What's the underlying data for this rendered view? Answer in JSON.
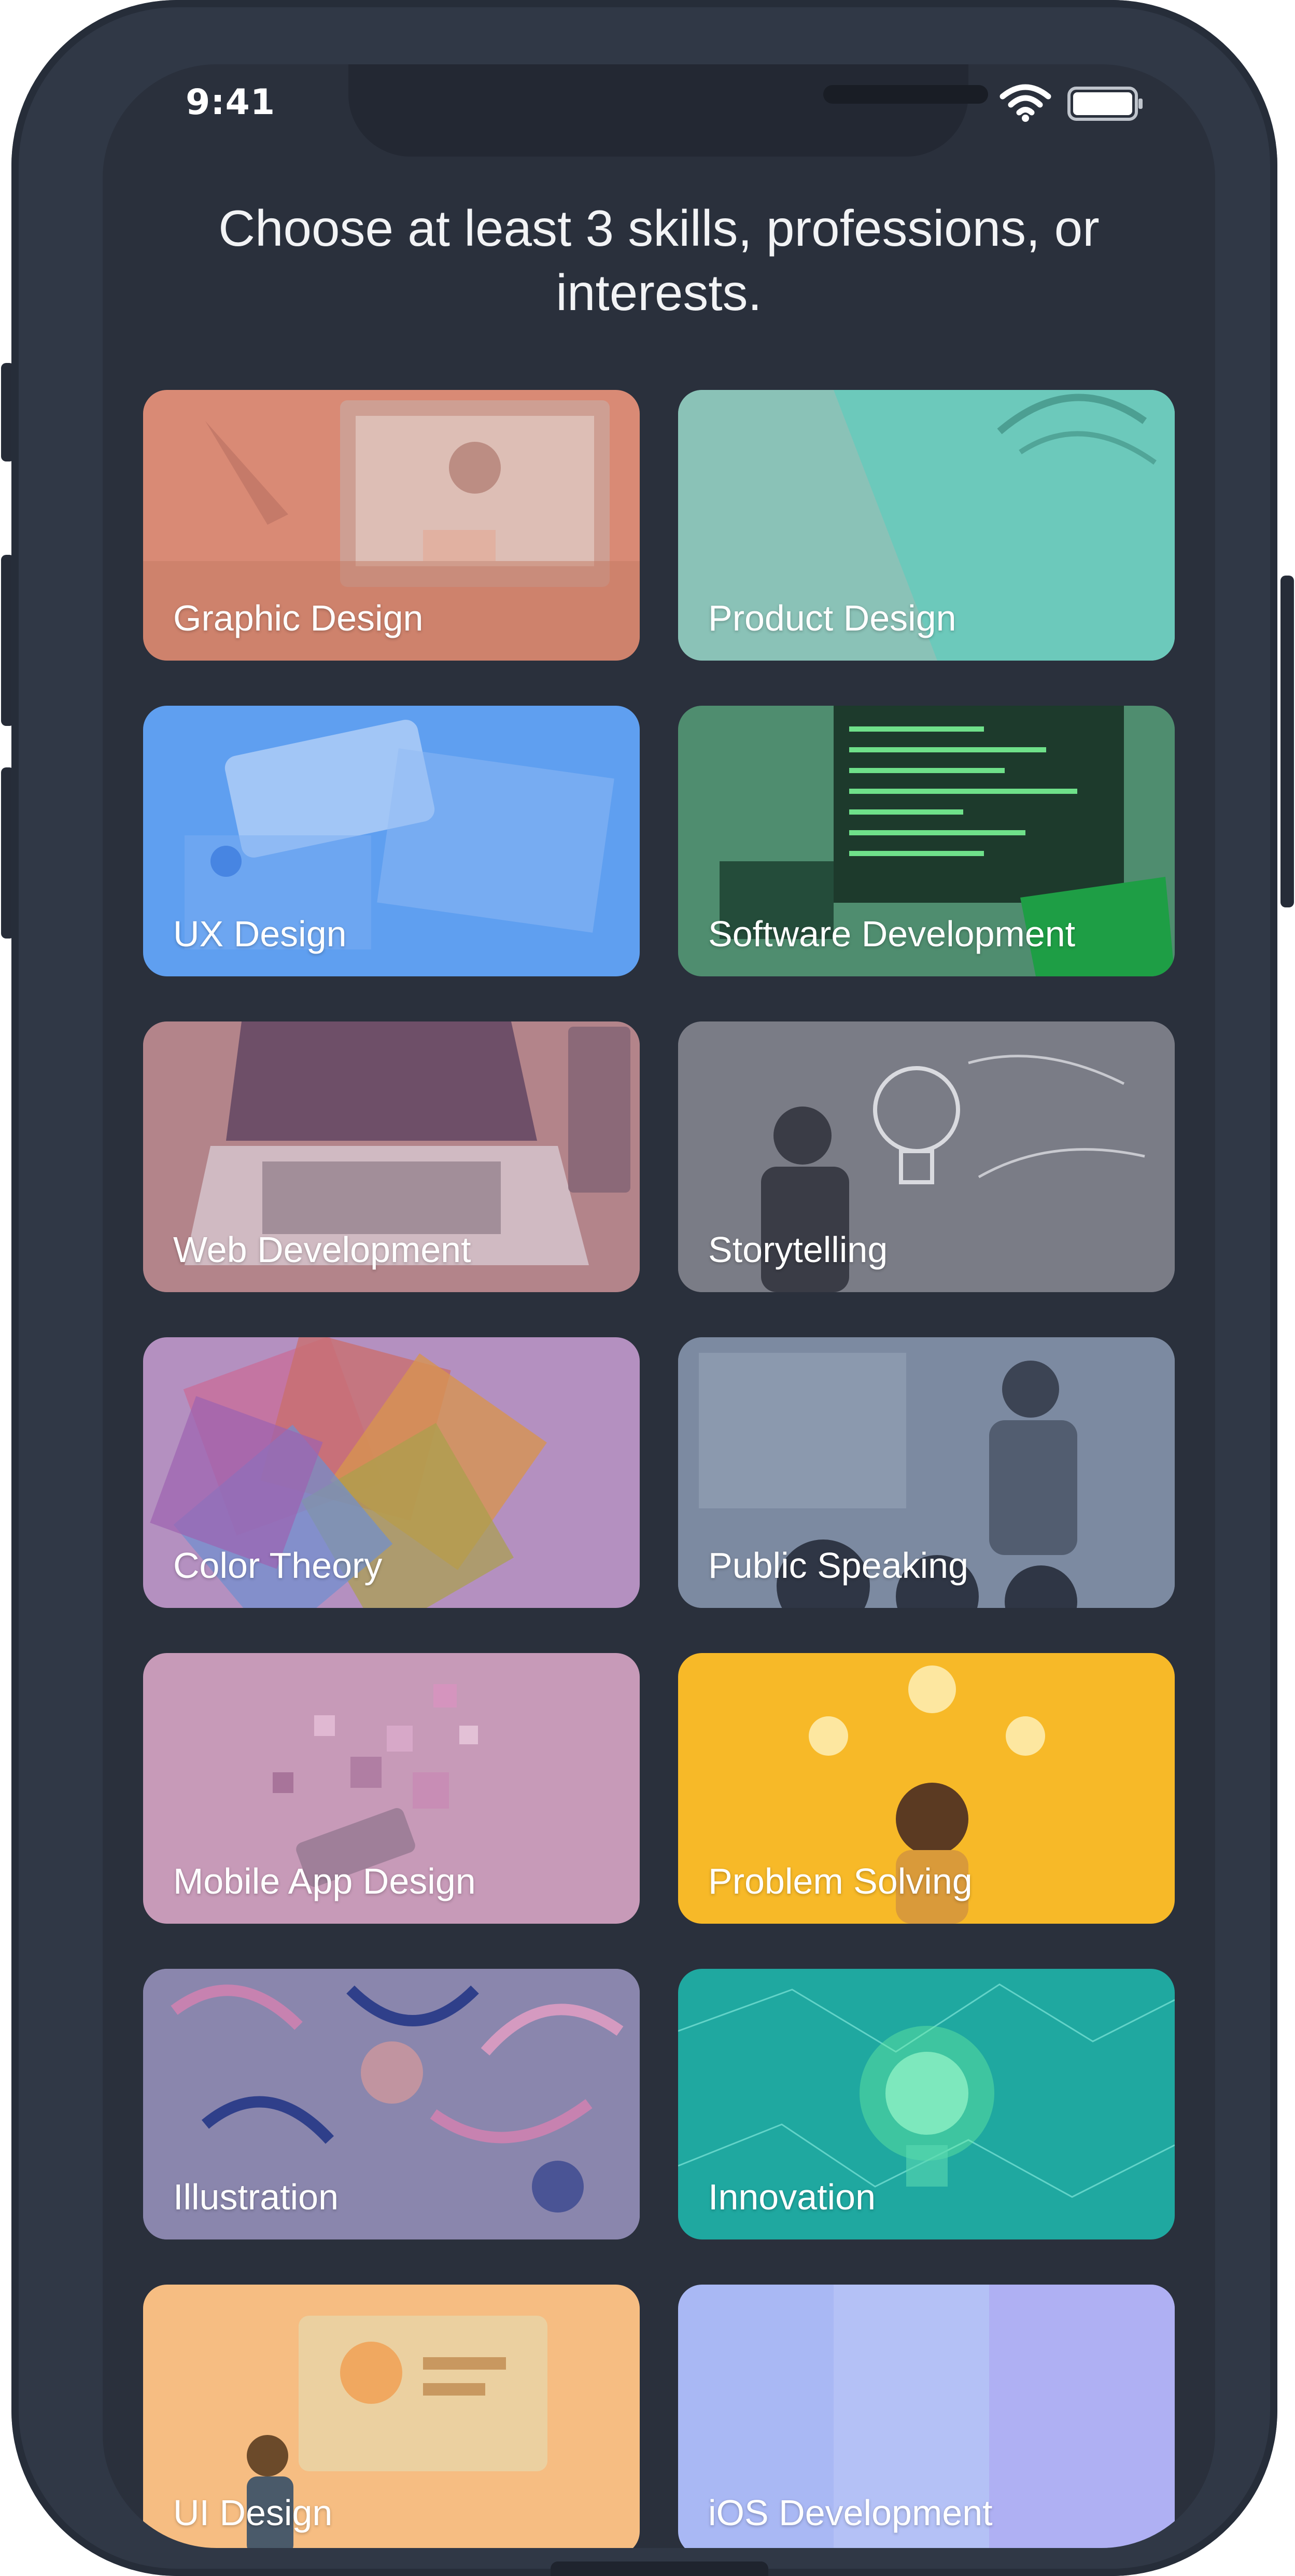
{
  "status_bar": {
    "time": "9:41"
  },
  "header": {
    "title": "Choose at least 3 skills, professions, or interests."
  },
  "colors": {
    "background": "#2a303c",
    "phone_frame": "#303846",
    "text": "#ffffff"
  },
  "icons": {
    "wifi": "wifi-icon",
    "battery": "battery-icon"
  },
  "tiles": [
    {
      "label": "Graphic Design",
      "color": "#d98a75"
    },
    {
      "label": "Product Design",
      "color": "#7ccfc0"
    },
    {
      "label": "UX Design",
      "color": "#5f9ff0"
    },
    {
      "label": "Software Development",
      "color": "#2f7f57"
    },
    {
      "label": "Web Development",
      "color": "#b07c8a"
    },
    {
      "label": "Storytelling",
      "color": "#6d6f7a"
    },
    {
      "label": "Color Theory",
      "color": "#b490c0"
    },
    {
      "label": "Public Speaking",
      "color": "#6e7d95"
    },
    {
      "label": "Mobile App Design",
      "color": "#c79ab8"
    },
    {
      "label": "Problem Solving",
      "color": "#f7b928"
    },
    {
      "label": "Illustration",
      "color": "#7d7aa3"
    },
    {
      "label": "Innovation",
      "color": "#1fa8a0"
    },
    {
      "label": "UI Design",
      "color": "#f6bd82"
    },
    {
      "label": "iOS Development",
      "color": "#a9b8f4"
    }
  ]
}
